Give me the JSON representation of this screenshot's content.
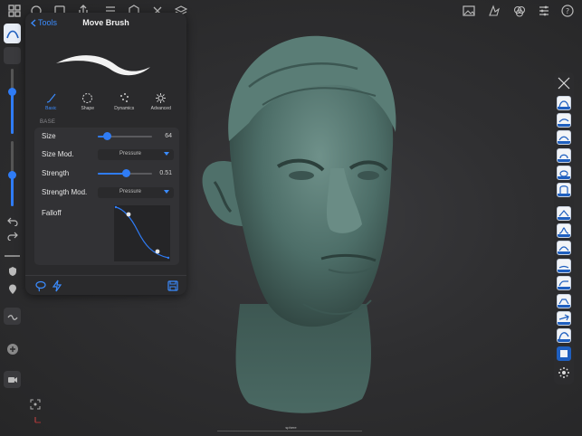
{
  "panel": {
    "back_label": "Tools",
    "title": "Move Brush",
    "tabs": [
      {
        "label": "Basic",
        "icon": "brush-icon",
        "active": true
      },
      {
        "label": "Shape",
        "icon": "shape-icon",
        "active": false
      },
      {
        "label": "Dynamics",
        "icon": "dynamics-icon",
        "active": false
      },
      {
        "label": "Advanced",
        "icon": "advanced-icon",
        "active": false
      }
    ],
    "section": "BASE",
    "size": {
      "label": "Size",
      "value": "64",
      "level": 0.17
    },
    "size_mod": {
      "label": "Size Mod.",
      "option": "Pressure"
    },
    "strength": {
      "label": "Strength",
      "value": "0.51",
      "level": 0.51
    },
    "strength_mod": {
      "label": "Strength Mod.",
      "option": "Pressure"
    },
    "falloff": {
      "label": "Falloff"
    }
  },
  "viewport": {
    "object_label": "sphere"
  },
  "left_sliders": {
    "radius_level": 0.65,
    "strength_level": 0.48
  },
  "colors": {
    "accent": "#2f7cf6",
    "panel": "#2a2a2c",
    "sculpt": "#4d6e68"
  }
}
